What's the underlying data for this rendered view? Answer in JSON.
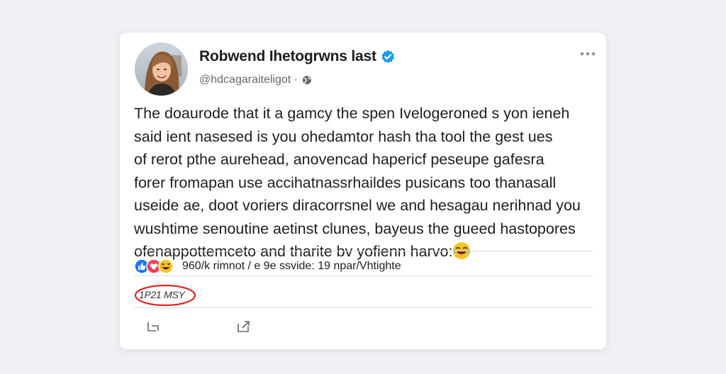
{
  "post": {
    "author_name": "Robwend Ihetogrwns last",
    "handle": "@hdcagaraiteligot ·",
    "body_lines": [
      "The doaurode that it a gamcy the spen Ivelogeroned s yon ieneh",
      "said ient nasesed is you ohedamtor hash tha tool the gest ues",
      "of rerot pthe aurehead, anovencad hapericf peseupe gafesra",
      "forer fromapan use accihatnassrhaildes pusicans too thanasall",
      "useide ae, doot voriers diracorrsnel we and hesagau nerihnad you",
      "wushtime senoutine aetinst clunes, bayeus the gueed hastopores",
      "ofenappottemceto and tharite bv yofienn harvo:"
    ],
    "body_emoji": "laughing-crying-emoji",
    "reactions_text": "960/k rimnot / e 9e ssvide: 19 npar/Vhtighte",
    "timestamp": "1P21 MSY"
  },
  "colors": {
    "verified": "#1d9bf0",
    "like": "#1877f2",
    "love": "#f33e58",
    "annotation": "#e02424"
  },
  "icons": {
    "verified": "verified-badge-icon",
    "globe": "globe-icon",
    "more": "more-options-icon",
    "reply": "reply-icon",
    "share": "share-icon"
  }
}
